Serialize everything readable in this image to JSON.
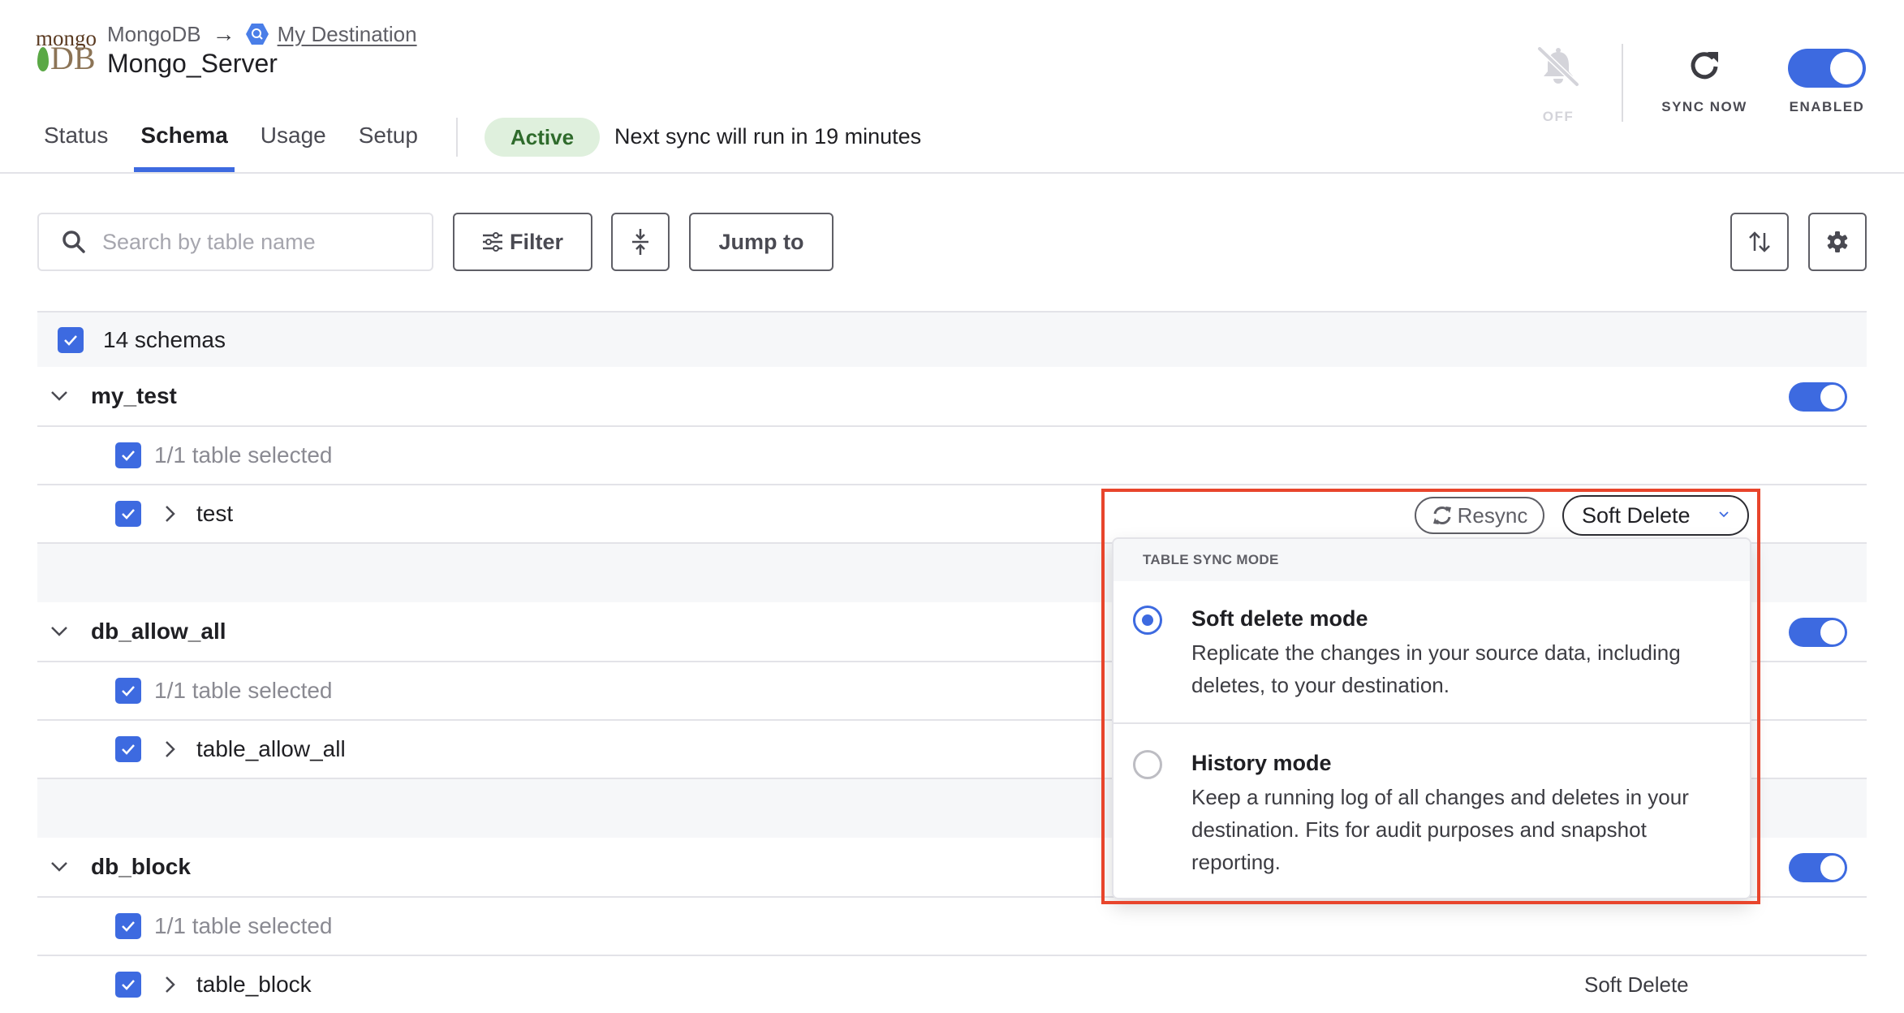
{
  "header": {
    "source_logo": "mongodb-logo",
    "logo_text_top": "mongo",
    "logo_text_bottom": "DB",
    "breadcrumb_source": "MongoDB",
    "breadcrumb_arrow": "→",
    "destination_icon": "bigquery-icon",
    "destination_link": "My Destination",
    "connector_name": "Mongo_Server"
  },
  "tabs": [
    {
      "label": "Status",
      "active": false
    },
    {
      "label": "Schema",
      "active": true
    },
    {
      "label": "Usage",
      "active": false
    },
    {
      "label": "Setup",
      "active": false
    }
  ],
  "status": {
    "badge": "Active",
    "next_sync": "Next sync will run in 19 minutes"
  },
  "controls": {
    "notifications_label": "OFF",
    "sync_now_label": "SYNC NOW",
    "enabled_label": "ENABLED",
    "enabled": true
  },
  "toolbar": {
    "search_placeholder": "Search by table name",
    "search_value": "",
    "filter_label": "Filter",
    "jump_to_label": "Jump to"
  },
  "schema_list": {
    "all_label": "14 schemas",
    "all_checked": true,
    "schemas": [
      {
        "name": "my_test",
        "enabled": true,
        "selection": "1/1 table selected",
        "tables": [
          {
            "name": "test",
            "checked": true,
            "sync_mode": "Soft Delete"
          }
        ]
      },
      {
        "name": "db_allow_all",
        "enabled": true,
        "selection": "1/1 table selected",
        "tables": [
          {
            "name": "table_allow_all",
            "checked": true,
            "sync_mode": ""
          }
        ]
      },
      {
        "name": "db_block",
        "enabled": true,
        "selection": "1/1 table selected",
        "tables": [
          {
            "name": "table_block",
            "checked": true,
            "sync_mode": "Soft Delete"
          }
        ]
      }
    ]
  },
  "sync_mode_menu": {
    "resync_label": "Resync",
    "selected_label": "Soft Delete",
    "header": "TABLE SYNC MODE",
    "options": [
      {
        "title": "Soft delete mode",
        "description": "Replicate the changes in your source data, including deletes, to your destination.",
        "selected": true
      },
      {
        "title": "History mode",
        "description": "Keep a running log of all changes and deletes in your destination. Fits for audit purposes and snapshot reporting.",
        "selected": false
      }
    ]
  },
  "colors": {
    "accent": "#3d6ae0",
    "active_badge_bg": "#dff0dd",
    "active_badge_text": "#2f6b2c",
    "highlight_border": "#e8452c"
  }
}
